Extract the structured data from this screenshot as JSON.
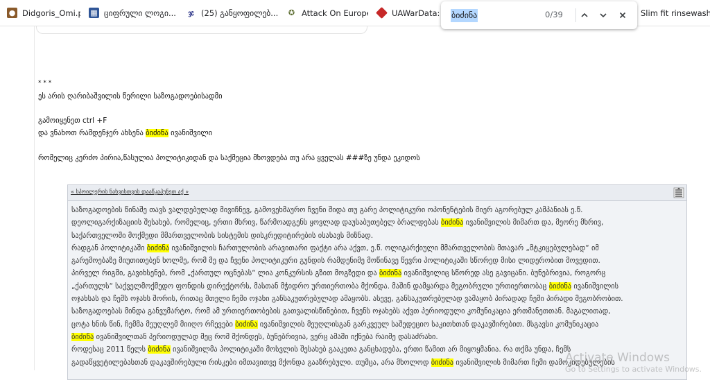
{
  "bookmarks": [
    {
      "label": "Didgoris_Omi.pdf",
      "icon": "snail-icon"
    },
    {
      "label": "ციფრული ლოგი...",
      "icon": "document-icon"
    },
    {
      "label": "(25) განყოფილებ...",
      "icon": "georgian-letter-icon"
    },
    {
      "label": "Attack On Europe:...",
      "icon": "attack-on-europe-icon"
    },
    {
      "label": "UAWarData: Trackin...",
      "icon": "uawardata-icon"
    },
    {
      "label": "Slim fit rinsewashed...",
      "icon": ""
    }
  ],
  "find": {
    "query": "ბიძინა",
    "count": "0/39",
    "prev_icon": "chevron-up-icon",
    "next_icon": "chevron-down-icon",
    "close_icon": "close-icon"
  },
  "post": {
    "stars": "* * *",
    "line1": "ეს არის ღარიბაშვილის წერილი საზოგადოებისადმი",
    "line2": "გამოიყენეთ ctrl +F",
    "line3_pre": "და ვნახოთ რამდენჯერ ახსენა ",
    "line3_hl": "ბიძინა",
    "line3_post": " ივანიშვილი",
    "line4": "რომელიც კერძო პირია,წასულია პოლიტიკიდან და საქმეცია მხოვდება თუ არა ყველას ###ზე უნდა ეკიდოს"
  },
  "quote": {
    "title": "« სპოილერის ნახვისთვის დააწკაპუნეთ აქ »",
    "icon": "format-justify-icon",
    "lines": [
      [
        {
          "t": "საზოგადოების წინაშე თავს ვალდებულად მივიჩნევ, გამოვეხმაურო ჩვენი შიდა თუ გარე პოლიტიკური ოპონენტების მიერ აგორებულ კამპანიას ე.წ."
        }
      ],
      [
        {
          "t": "დეოლიგარქიზაციის შესახებ, რომელიც, ერთი მხრივ, წარმოადგენს ყოვლად დაუსაბუთებელ ბრალდებას "
        },
        {
          "t": "ბიძინა",
          "h": true
        },
        {
          "t": " ივანიშვილის მიმართ და, მეორე მხრივ,"
        }
      ],
      [
        {
          "t": "საქართველოში მოქმედი მმართველობის სისტემის დისკრედიტირების ისახავს მიზნად."
        }
      ],
      [
        {
          "t": "რადგან პოლიტიკაში "
        },
        {
          "t": "ბიძინა",
          "h": true
        },
        {
          "t": " ივანიშვილის ჩართულობის არავითარი ფაქტი არა აქვთ, ე.წ. ოლიგარქიული მმართველობის მთავარ „მტკიცებულებად“ იმ"
        }
      ],
      [
        {
          "t": "გარემოებაზე მიუთითებენ ხოლმე, რომ მე და ჩვენი პოლიტიკური გუნდის რამდენიმე მოწინავე წევრი პოლიტიკაში სწორედ მისი ლიდერობით მოვედით."
        }
      ],
      [
        {
          "t": "პირველ რიგში, გავიხსენებ, რომ „ქართულ ოცნებას“ ლია კონკურსის გზით მოგზედი და "
        },
        {
          "t": "ბიძინა",
          "h": true
        },
        {
          "t": " ივანიშვილიც სწორედ ასე გავიცანი. ბუნებრივია, როგორც"
        }
      ],
      [
        {
          "t": "„ქართულს“ საქველმოქმედო ფონდის დირექტორს, მასთან მჭიდრო ურთიერთობა მქონდა. მაშინ დამყარდა მეგობრული ურთიერთობაც "
        },
        {
          "t": "ბიძინა",
          "h": true
        },
        {
          "t": " ივანიშვილის"
        }
      ],
      [
        {
          "t": "ოჯახსას და ჩემს ოჯახს შორის, რითაც მთელი ჩემი ოჯახი განსაკუთრებულად ამაყობს. ასევე, განსაკუთრებულად ვამაყობ პირადად ჩემი პირადი მეგობრობით."
        }
      ],
      [
        {
          "t": "საზოგადოებას მინდა განვუმარტო, რომ ამ ურთიერთობების გათვალისწინებით, ჩვენს ოჯახებს აქვთ პერიოდული კომუნიკაცია ერთმანეთთან. მაგალითად,"
        }
      ],
      [
        {
          "t": "ცოტა ხნის წინ, ჩემმა მეუღლემ მიიღო რჩევები "
        },
        {
          "t": "ბიძინა",
          "h": true
        },
        {
          "t": " ივანიშვილის მეუღლისგან გარკვეულ საშედეციო საკითხთან დაკავშირებით. მსგავსი კომუნიკაცია"
        }
      ],
      [
        {
          "t": "ბიძინა",
          "h": true
        },
        {
          "t": " ივანიშვილთან პერიოდულად მეც რომ მქონდეს, ბუნებრივია, ვერც ამაში იქნება რაიმე დასაძრახი."
        }
      ],
      [
        {
          "t": "როდესაც 2011 წელს "
        },
        {
          "t": "ბიძინა",
          "h": true
        },
        {
          "t": " ივანიშვილმა პოლიტიკაში მოსვლის შესახებ გააკეთა განცხადება, ერთი წამით არ მიყოყმანია. რა თქმა უნდა, ჩემს"
        }
      ],
      [
        {
          "t": "გადაწყვეტილებასთან დაკავშირებული რისკები იმთავითვე მქონდა გააზრებული. თუმცა, არა მხოლოდ "
        },
        {
          "t": "ბიძინა",
          "h": true
        },
        {
          "t": " ივანიშვილის მიმართ ჩემი დამოკიდებულების"
        }
      ]
    ]
  },
  "watermark": {
    "title": "Activate Windows",
    "subtitle": "Go to Settings to activate Windows."
  }
}
